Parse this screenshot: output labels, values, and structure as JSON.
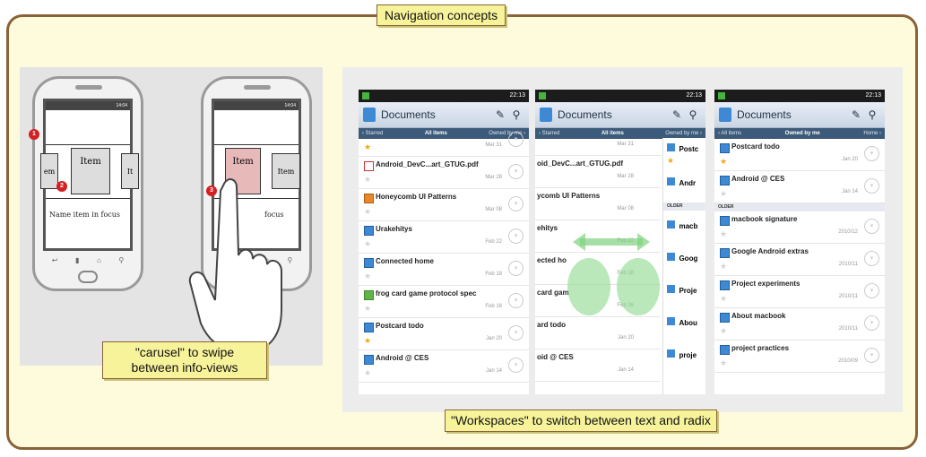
{
  "title": "Navigation concepts",
  "left": {
    "caption_line1": "\"carusel\" to swipe",
    "caption_line2": "between info-views",
    "phone1": {
      "status": "14:04",
      "card_left": "em",
      "card_main": "Item",
      "card_right": "It",
      "focus_text": "Name item in focus"
    },
    "phone2": {
      "status": "14:04",
      "card_main": "Item",
      "card_right": "Item",
      "focus_text": "focus"
    },
    "markers": [
      "1",
      "2",
      "3"
    ]
  },
  "right": {
    "caption": "\"Workspaces\" to switch between text and radix",
    "app_title": "Documents",
    "time": "22:13",
    "older_label": "OLDER",
    "screen1": {
      "tabs": [
        "‹ Starred",
        "All items",
        "Owned by me ›"
      ],
      "rows": [
        {
          "title": "",
          "date": "Mar 31",
          "icon": "doc",
          "star": true
        },
        {
          "title": "Android_DevC...art_GTUG.pdf",
          "date": "Mar 28",
          "icon": "pdf",
          "star": false
        },
        {
          "title": "Honeycomb UI Patterns",
          "date": "Mar 08",
          "icon": "ppt",
          "star": false
        },
        {
          "title": "Urakehitys",
          "date": "Feb 22",
          "icon": "doc",
          "star": false
        },
        {
          "title": "Connected home",
          "date": "Feb 18",
          "icon": "doc",
          "star": false
        },
        {
          "title": "frog card game protocol spec",
          "date": "Feb 16",
          "icon": "sheet",
          "star": false
        },
        {
          "title": "Postcard todo",
          "date": "Jan 20",
          "icon": "doc",
          "star": true
        },
        {
          "title": "Android @ CES",
          "date": "Jan 14",
          "icon": "doc",
          "star": false
        }
      ]
    },
    "screen2": {
      "tabs": [
        "‹ Starred",
        "All items",
        "Owned by me ›"
      ],
      "rows": [
        {
          "title": "",
          "date": "Mar 31"
        },
        {
          "title": "oid_DevC...art_GTUG.pdf",
          "date": "Mar 28"
        },
        {
          "title": "ycomb UI Patterns",
          "date": "Mar 08"
        },
        {
          "title": "ehitys",
          "date": "Feb 22"
        },
        {
          "title": "ected ho",
          "date": "Feb 18"
        },
        {
          "title": "card gam",
          "date": "Feb 16"
        },
        {
          "title": "ard todo",
          "date": "Jan 20"
        },
        {
          "title": "oid @ CES",
          "date": "Jan 14"
        }
      ],
      "peek": [
        "Postc",
        "Andr",
        "macb",
        "Goog",
        "Proje",
        "Abou",
        "proje"
      ]
    },
    "screen3": {
      "tabs": [
        "‹ All items",
        "Owned by me",
        "Home ›"
      ],
      "rows": [
        {
          "title": "Postcard todo",
          "date": "Jan 20",
          "star": true
        },
        {
          "title": "Android @ CES",
          "date": "Jan 14",
          "star": false
        }
      ],
      "older_rows": [
        {
          "title": "macbook signature",
          "date": "2010/12"
        },
        {
          "title": "Google Android extras",
          "date": "2010/11"
        },
        {
          "title": "Project experiments",
          "date": "2010/11"
        },
        {
          "title": "About macbook",
          "date": "2010/11"
        },
        {
          "title": "project practices",
          "date": "2010/09"
        }
      ]
    }
  },
  "colors": {
    "frame_border": "#8a6237",
    "frame_bg": "#fdfbdc",
    "tag_bg": "#f7f39a",
    "android_tab": "#3c5a7a"
  }
}
